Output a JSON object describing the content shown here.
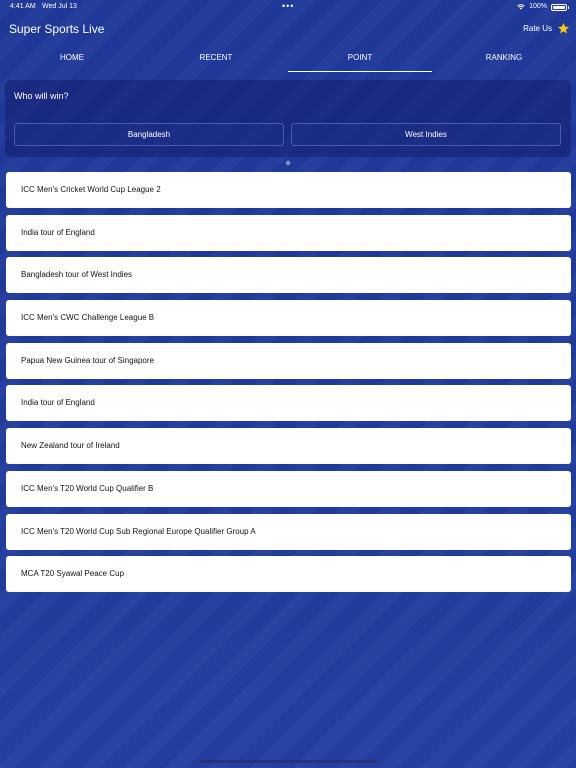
{
  "status_bar": {
    "time": "4:41 AM",
    "date": "Wed Jul 13",
    "dots": "•••",
    "battery": "100%"
  },
  "header": {
    "title": "Super Sports Live",
    "rate_us": "Rate Us"
  },
  "tabs": [
    {
      "label": "HOME",
      "active": false
    },
    {
      "label": "RECENT",
      "active": false
    },
    {
      "label": "POINT",
      "active": true
    },
    {
      "label": "RANKING",
      "active": false
    }
  ],
  "poll": {
    "question": "Who will win?",
    "options": [
      "Bangladesh",
      "West Indies"
    ]
  },
  "series": [
    "ICC Men's Cricket World Cup League 2",
    "India tour of England",
    "Bangladesh tour of West Indies",
    "ICC Men's CWC Challenge League B",
    "Papua New Guinea tour of Singapore",
    "India tour of England",
    "New Zealand tour of Ireland",
    "ICC Men's T20 World Cup Qualifier B",
    "ICC Men's T20 World Cup Sub Regional Europe Qualifier Group A",
    "MCA T20 Syawal Peace Cup"
  ],
  "colors": {
    "background": "#213b9c",
    "star": "#f5c518",
    "card": "#ffffff"
  }
}
